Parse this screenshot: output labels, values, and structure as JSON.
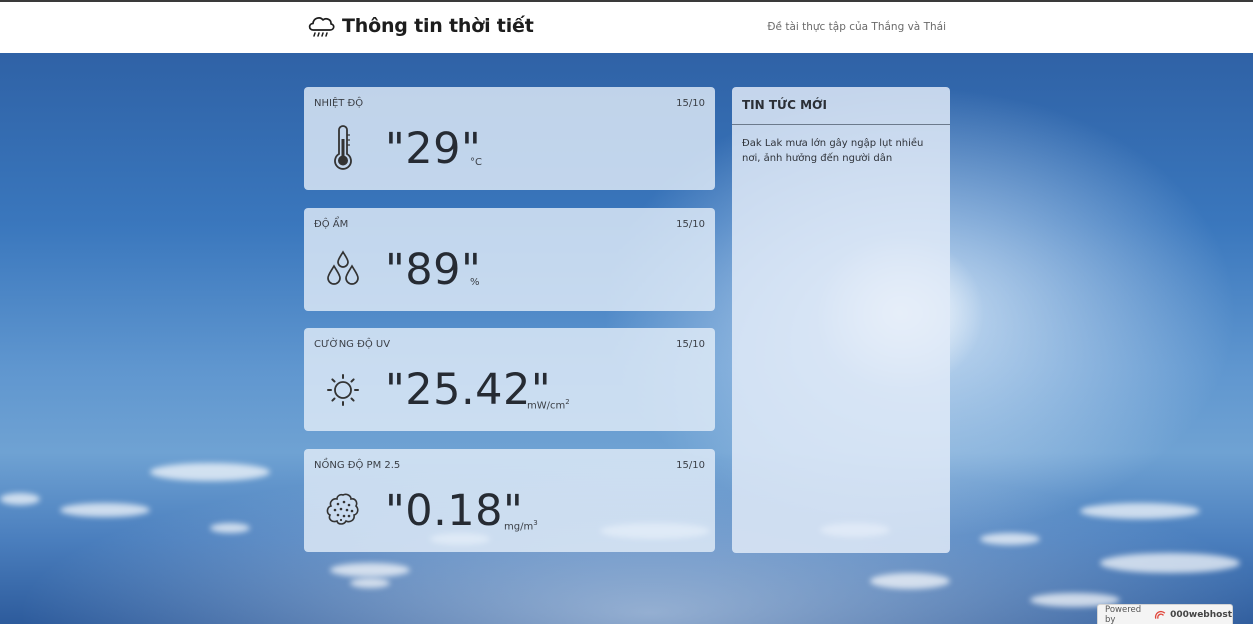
{
  "header": {
    "icon": "rain-cloud-icon",
    "title": "Thông tin thời tiết",
    "subtitle": "Đề tài thực tập của Thắng và Thái"
  },
  "cards": [
    {
      "label": "NHIỆT ĐỘ",
      "date": "15/10",
      "icon": "thermometer-icon",
      "value": "\"29\"",
      "unit": "°C"
    },
    {
      "label": "ĐỘ ẨM",
      "date": "15/10",
      "icon": "humidity-drops-icon",
      "value": "\"89\"",
      "unit": "%"
    },
    {
      "label": "CƯỜNG ĐỘ UV",
      "date": "15/10",
      "icon": "sun-icon",
      "value": "\"25.42\"",
      "unit": "mW/cm",
      "unit_sup": "2"
    },
    {
      "label": "NỒNG ĐỘ PM 2.5",
      "date": "15/10",
      "icon": "dust-particles-icon",
      "value": "\"0.18\"",
      "unit": "mg/m",
      "unit_sup": "3"
    }
  ],
  "news": {
    "title": "TIN TỨC MỚI",
    "items": [
      {
        "text": "Đak Lak mưa lớn gây ngập lụt nhiều nơi, ảnh hưởng đến người dân"
      }
    ]
  },
  "footer_badge": {
    "prefix": "Powered by",
    "brand": "000webhost"
  },
  "colors": {
    "header_bg": "#ffffff",
    "card_bg": "#e1ebf8",
    "sky_blue": "#3a77bd"
  }
}
